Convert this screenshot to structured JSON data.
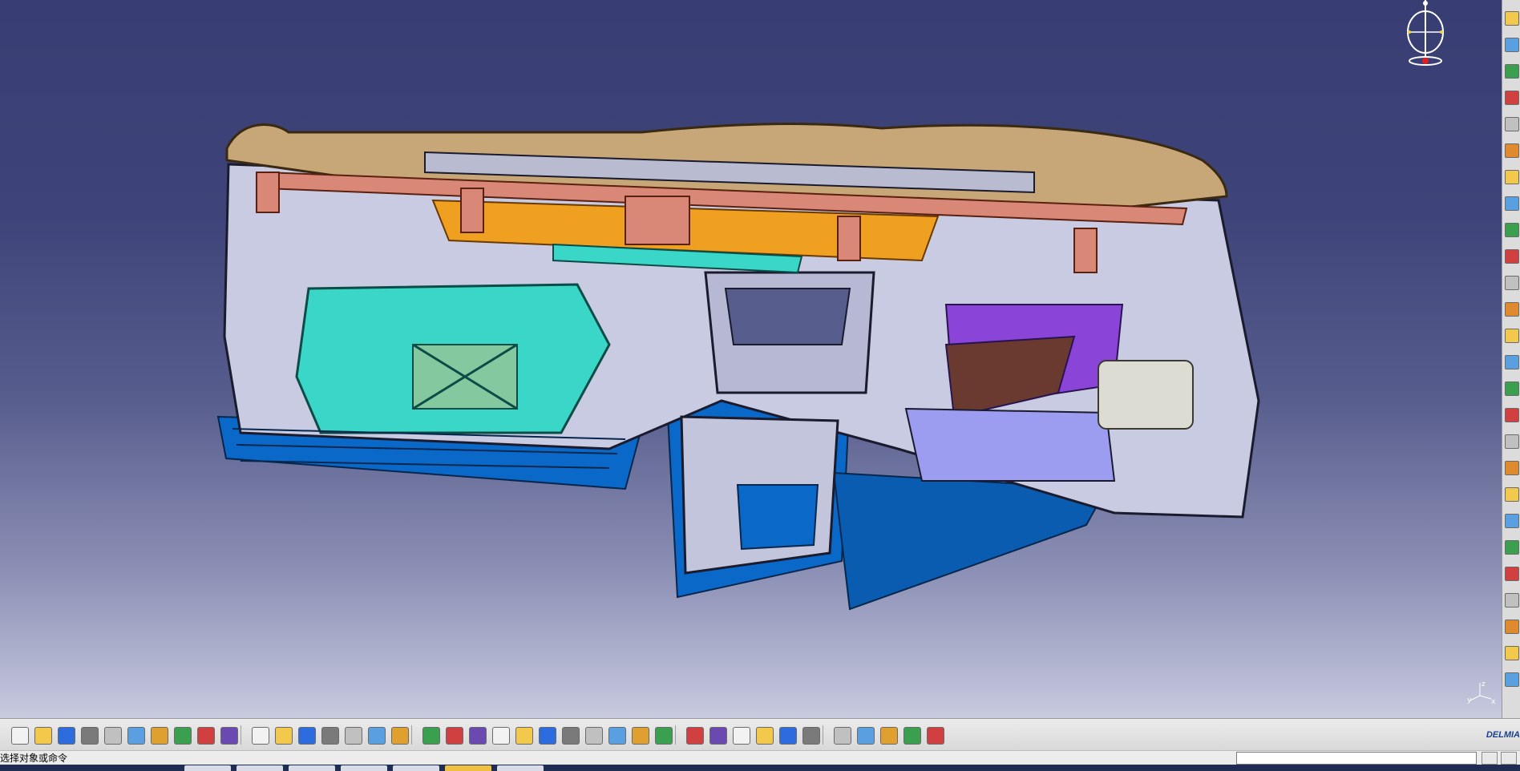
{
  "app": {
    "status_prompt": "选择对象或命令",
    "brand": "DELMIA",
    "command_input_value": "",
    "axis_labels": {
      "z": "z",
      "y": "y",
      "x": "x"
    }
  },
  "colors": {
    "viewport_top": "#383e73",
    "viewport_bottom": "#c8cadf",
    "top_pad": "#c7a678",
    "skeleton": "#c9cbe3",
    "orange_duct": "#f0a020",
    "airbag": "#3ad6c8",
    "lower_blue": "#0a68c8",
    "salmon": "#d98877"
  },
  "bottom_toolbar": {
    "icons": [
      "new-file-icon",
      "open-folder-icon",
      "save-icon",
      "print-icon",
      "cut-icon",
      "copy-icon",
      "paste-icon",
      "undo-icon",
      "redo-icon",
      "whats-this-icon",
      "formula-icon",
      "knowledge-icon",
      "grip-icon",
      "table-icon",
      "tree-icon",
      "lock-icon",
      "fly-mode-icon",
      "fit-all-icon",
      "pan-icon",
      "rotate-icon",
      "zoom-in-icon",
      "zoom-out-icon",
      "normal-view-icon",
      "multi-view-icon",
      "iso-view-icon",
      "shading-icon",
      "hide-show-icon",
      "swap-visible-icon",
      "capture-icon",
      "measure-icon",
      "clash-icon",
      "sectioning-icon",
      "distance-icon",
      "spin-icon",
      "apply-material-icon",
      "render-icon",
      "color-icon",
      "scene-icon",
      "grid-icon"
    ]
  },
  "right_toolbar": {
    "icons": [
      "select-icon",
      "sketch-icon",
      "pad-icon",
      "pocket-icon",
      "shaft-icon",
      "groove-icon",
      "hole-icon",
      "rib-icon",
      "slot-icon",
      "stiffener-icon",
      "loft-icon",
      "fillet-icon",
      "chamfer-icon",
      "draft-icon",
      "shell-icon",
      "thickness-icon",
      "thread-icon",
      "split-icon",
      "translate-icon",
      "mirror-icon",
      "pattern-icon",
      "scale-icon",
      "boolean-icon",
      "constraint-icon",
      "annotation-icon",
      "axis-system-icon"
    ]
  }
}
